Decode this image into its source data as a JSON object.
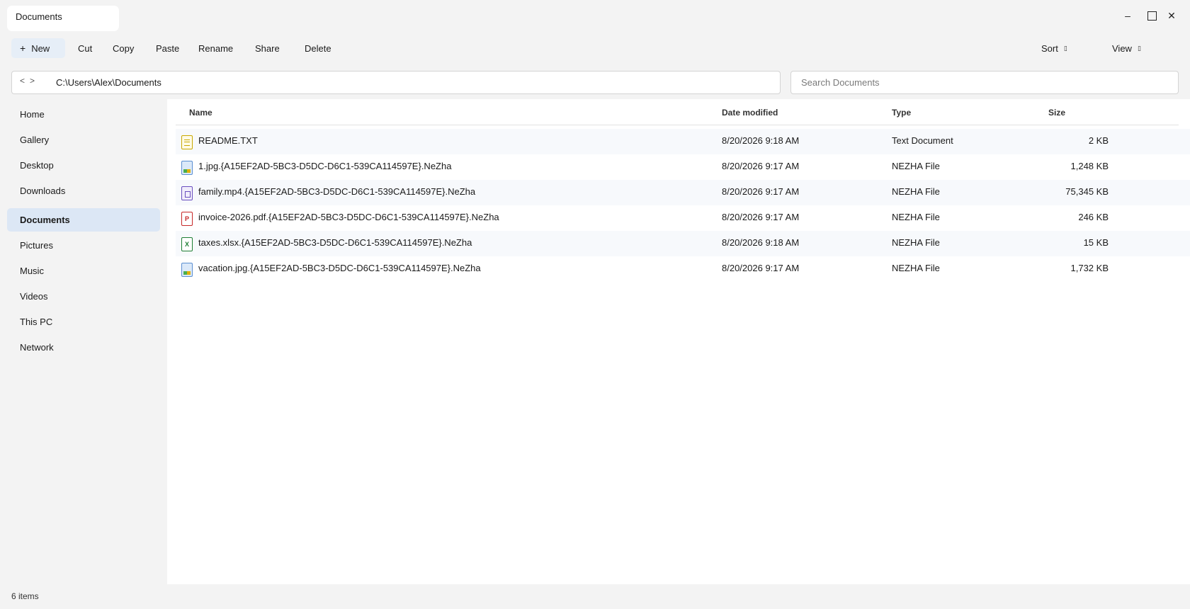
{
  "window": {
    "tab_title": "Documents",
    "controls": {
      "minimize": "–",
      "close": "✕"
    }
  },
  "toolbar": {
    "new_label": "New",
    "new_icon": "+",
    "cut_label": "Cut",
    "copy_label": "Copy",
    "paste_label": "Paste",
    "rename_label": "Rename",
    "share_label": "Share",
    "delete_label": "Delete",
    "sort_label": "Sort",
    "view_label": "View",
    "chevron_glyph": "▯"
  },
  "address": {
    "back_glyph": "<",
    "forward_glyph": ">",
    "path": "C:\\Users\\Alex\\Documents"
  },
  "search": {
    "placeholder": "Search Documents",
    "value": ""
  },
  "sidebar": {
    "items": [
      {
        "label": "Home",
        "active": false
      },
      {
        "label": "Gallery",
        "active": false
      },
      {
        "label": "Desktop",
        "active": false
      },
      {
        "label": "Downloads",
        "active": false
      },
      {
        "label": "Documents",
        "active": true
      },
      {
        "label": "Pictures",
        "active": false
      },
      {
        "label": "Music",
        "active": false
      },
      {
        "label": "Videos",
        "active": false
      },
      {
        "label": "This PC",
        "active": false
      },
      {
        "label": "Network",
        "active": false
      }
    ]
  },
  "file_list": {
    "headers": {
      "name": "Name",
      "date": "Date modified",
      "type": "Type",
      "size": "Size"
    },
    "rows": [
      {
        "icon": "text-file-icon",
        "icon_text": "",
        "name": "README.TXT",
        "date": "8/20/2026 9:18 AM",
        "type": "Text Document",
        "size": "2 KB"
      },
      {
        "icon": "image-file-icon",
        "icon_text": "",
        "name": "1.jpg.{A15EF2AD-5BC3-D5DC-D6C1-539CA114597E}.NeZha",
        "date": "8/20/2026 9:17 AM",
        "type": "NEZHA File",
        "size": "1,248 KB"
      },
      {
        "icon": "video-file-icon",
        "icon_text": "",
        "name": "family.mp4.{A15EF2AD-5BC3-D5DC-D6C1-539CA114597E}.NeZha",
        "date": "8/20/2026 9:17 AM",
        "type": "NEZHA File",
        "size": "75,345 KB"
      },
      {
        "icon": "pdf-file-icon",
        "icon_text": "P",
        "name": "invoice-2026.pdf.{A15EF2AD-5BC3-D5DC-D6C1-539CA114597E}.NeZha",
        "date": "8/20/2026 9:17 AM",
        "type": "NEZHA File",
        "size": "246 KB"
      },
      {
        "icon": "spreadsheet-file-icon",
        "icon_text": "X",
        "name": "taxes.xlsx.{A15EF2AD-5BC3-D5DC-D6C1-539CA114597E}.NeZha",
        "date": "8/20/2026 9:18 AM",
        "type": "NEZHA File",
        "size": "15 KB"
      },
      {
        "icon": "image-file-icon",
        "icon_text": "",
        "name": "vacation.jpg.{A15EF2AD-5BC3-D5DC-D6C1-539CA114597E}.NeZha",
        "date": "8/20/2026 9:17 AM",
        "type": "NEZHA File",
        "size": "1,732 KB"
      }
    ]
  },
  "status": {
    "item_count": "6 items"
  },
  "colors": {
    "accent_selected": "#dce7f5",
    "new_button_bg": "#e6eef7",
    "window_bg": "#f3f3f3"
  }
}
